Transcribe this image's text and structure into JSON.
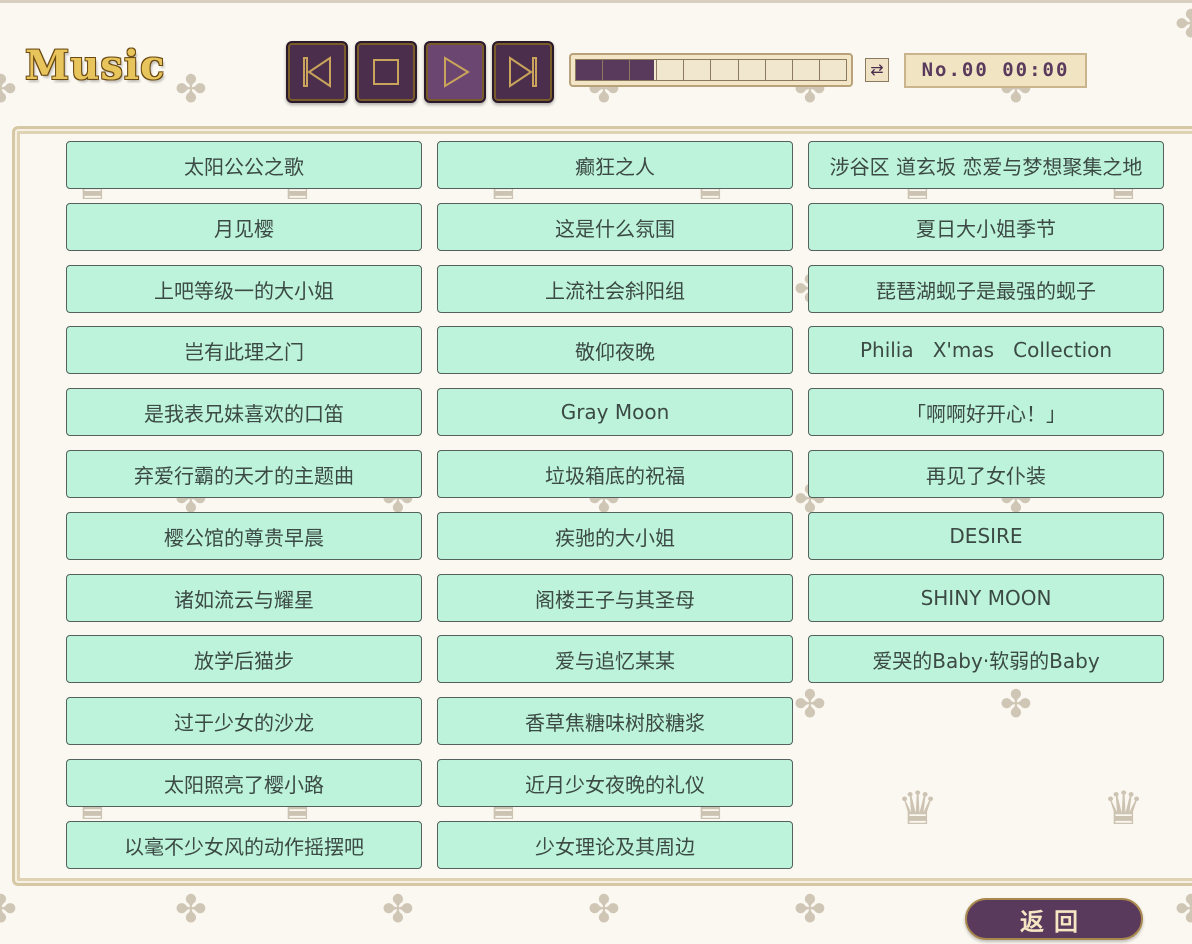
{
  "title": "Music",
  "controls": {
    "prev_icon": "skip-previous-icon",
    "stop_icon": "stop-icon",
    "play_icon": "play-icon",
    "next_icon": "skip-next-icon",
    "repeat_icon": "repeat-icon",
    "repeat_glyph": "⇄"
  },
  "progress": {
    "fraction": 0.29,
    "segments": 10
  },
  "track_info": "No.00 00:00",
  "songs": [
    [
      "太阳公公之歌",
      "癫狂之人",
      "涉谷区 道玄坂 恋爱与梦想聚集之地"
    ],
    [
      "月见樱",
      "这是什么氛围",
      "夏日大小姐季节"
    ],
    [
      "上吧等级一的大小姐",
      "上流社会斜阳组",
      "琵琶湖蚬子是最强的蚬子"
    ],
    [
      "岂有此理之门",
      "敬仰夜晚",
      "Philia   X'mas   Collection"
    ],
    [
      "是我表兄妹喜欢的口笛",
      "Gray Moon",
      "「啊啊好开心！」"
    ],
    [
      "弃爱行霸的天才的主题曲",
      "垃圾箱底的祝福",
      "再见了女仆装"
    ],
    [
      "樱公馆的尊贵早晨",
      "疾驰的大小姐",
      "DESIRE"
    ],
    [
      "诸如流云与耀星",
      "阁楼王子与其圣母",
      "SHINY MOON"
    ],
    [
      "放学后猫步",
      "爱与追忆某某",
      "爱哭的Baby·软弱的Baby"
    ],
    [
      "过于少女的沙龙",
      "香草焦糖味树胶糖浆",
      ""
    ],
    [
      "太阳照亮了樱小路",
      "近月少女夜晚的礼仪",
      ""
    ],
    [
      "以毫不少女风的动作摇摆吧",
      "少女理论及其周边",
      ""
    ]
  ],
  "back_button": "返回",
  "colors": {
    "song_bg": "#bdf3da",
    "accent_purple": "#5a3a5c",
    "gold": "#e8c55c"
  }
}
